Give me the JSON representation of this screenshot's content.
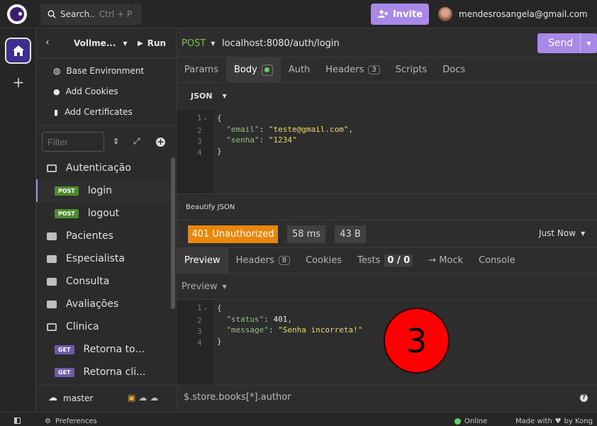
{
  "topbar": {
    "search_label": "Search..",
    "search_shortcut": "Ctrl + P",
    "invite_label": "Invite",
    "account_email": "mendesrosangela@gmail.com"
  },
  "sidebar": {
    "project_name": "Vollme...",
    "run_label": "Run",
    "menu": [
      {
        "label": "Base Environment",
        "icon": "globe-icon"
      },
      {
        "label": "Add Cookies",
        "icon": "cookie-icon"
      },
      {
        "label": "Add Certificates",
        "icon": "certificate-icon"
      }
    ],
    "filter_placeholder": "Filter",
    "tree": [
      {
        "type": "folder-open",
        "label": "Autenticação"
      },
      {
        "type": "request",
        "method": "POST",
        "label": "login",
        "selected": true
      },
      {
        "type": "request",
        "method": "POST",
        "label": "logout"
      },
      {
        "type": "folder",
        "label": "Pacientes"
      },
      {
        "type": "folder",
        "label": "Especialista"
      },
      {
        "type": "folder",
        "label": "Consulta"
      },
      {
        "type": "folder",
        "label": "Avaliações"
      },
      {
        "type": "folder-open",
        "label": "Clinica"
      },
      {
        "type": "request",
        "method": "GET",
        "label": "Retorna to..."
      },
      {
        "type": "request",
        "method": "GET",
        "label": "Retorna cli..."
      }
    ],
    "branch": "master"
  },
  "request": {
    "method": "POST",
    "url": "localhost:8080/auth/login",
    "send_label": "Send",
    "tabs": [
      "Params",
      "Body",
      "Auth",
      "Headers",
      "Scripts",
      "Docs"
    ],
    "headers_count": "3",
    "body_type": "JSON",
    "body_lines": [
      "1",
      "2",
      "3",
      "4"
    ],
    "body": {
      "email_key": "\"email\"",
      "email_val": "\"teste@gmail.com\"",
      "senha_key": "\"senha\"",
      "senha_val": "\"1234\""
    },
    "beautify_label": "Beautify JSON"
  },
  "response": {
    "status": "401 Unauthorized",
    "time": "58 ms",
    "size": "43 B",
    "when": "Just Now",
    "tabs": [
      "Preview",
      "Headers",
      "Cookies",
      "Tests",
      "→ Mock",
      "Console"
    ],
    "headers_count": "8",
    "tests_count": "0 / 0",
    "preview_mode": "Preview",
    "lines": [
      "1",
      "2",
      "3",
      "4"
    ],
    "body": {
      "status_key": "\"status\"",
      "status_val": "401",
      "message_key": "\"message\"",
      "message_val": "\"Senha incorreta!\""
    },
    "filter_expr": "$.store.books[*].author"
  },
  "annotation": {
    "step": "3"
  },
  "statusbar": {
    "preferences": "Preferences",
    "online": "Online",
    "made_with": "Made with",
    "by": "by Kong"
  },
  "colors": {
    "accent": "#a889e8",
    "status_error": "#e8870a",
    "post": "#4e8a2f",
    "get": "#6e5ca8",
    "step_circle": "#ff0000"
  }
}
